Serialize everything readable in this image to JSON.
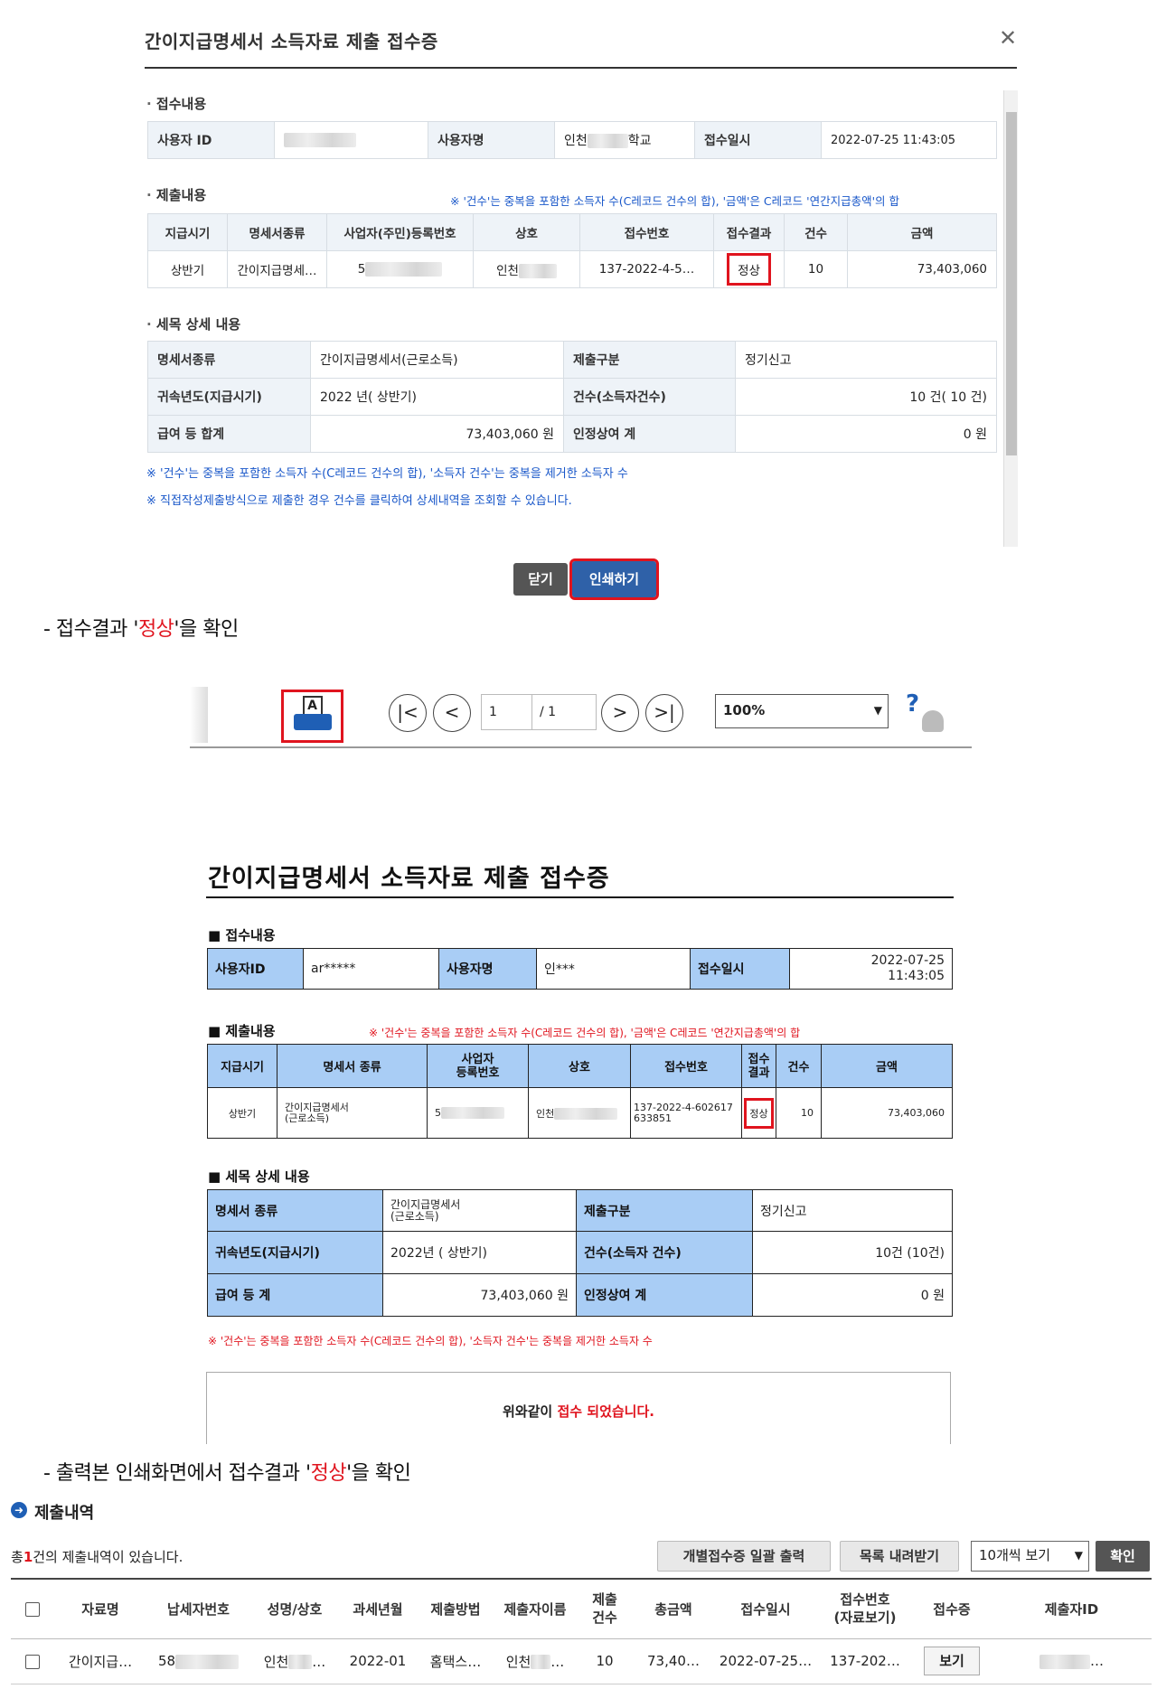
{
  "popup": {
    "title": "간이지급명세서 소득자료 제출 접수증",
    "close_glyph": "✕",
    "sec1_label": "접수내용",
    "user_id_label": "사용자 ID",
    "user_name_label": "사용자명",
    "user_name_prefix": "인천",
    "user_name_suffix": "학교",
    "receipt_time_label": "접수일시",
    "receipt_time": "2022-07-25 11:43:05",
    "sec2_label": "제출내용",
    "sec2_note": "※ '건수'는 중복을 포함한 소득자 수(C레코드 건수의 합), '금액'은 C레코드 '연간지급총액'의 합",
    "sub_headers": [
      "지급시기",
      "명세서종류",
      "사업자(주민)등록번호",
      "상호",
      "접수번호",
      "접수결과",
      "건수",
      "금액"
    ],
    "sub_row": {
      "period": "상반기",
      "type": "간이지급명세…",
      "reg_prefix": "5",
      "name_prefix": "인천",
      "receipt_no": "137-2022-4-5…",
      "result": "정상",
      "count": "10",
      "amount": "73,403,060"
    },
    "sec3_label": "세목 상세 내용",
    "d_type_label": "명세서종류",
    "d_type": "간이지급명세서(근로소득)",
    "d_kind_label": "제출구분",
    "d_kind": "정기신고",
    "d_year_label": "귀속년도(지급시기)",
    "d_year": "2022 년( 상반기)",
    "d_count_label": "건수(소득자건수)",
    "d_count": "10  건( 10 건)",
    "d_pay_label": "급여 등 합계",
    "d_pay": "73,403,060 원",
    "d_bonus_label": "인정상여 계",
    "d_bonus": "0 원",
    "note1": "※ '건수'는 중복을 포함한 소득자 수(C레코드 건수의 합), '소득자 건수'는 중복을 제거한 소득자 수",
    "note2": "※ 직접작성제출방식으로 제출한 경우 건수를 클릭하여 상세내역을 조회할 수 있습니다.",
    "btn_close": "닫기",
    "btn_print": "인쇄하기"
  },
  "caption1": {
    "pre": "- 접수결과 '",
    "hl": "정상",
    "post": "'을 확인"
  },
  "viewer": {
    "print_glyph": "A",
    "first": "|<",
    "prev": "<",
    "next": ">",
    "last": ">|",
    "page_current": "1",
    "page_total": "/ 1",
    "zoom": "100%",
    "help": "?"
  },
  "printed": {
    "title": "간이지급명세서 소득자료 제출 접수증",
    "sec1": "접수내용",
    "uid_label": "사용자ID",
    "uid": "ar*****",
    "uname_label": "사용자명",
    "uname": "인***",
    "time_label": "접수일시",
    "time_date": "2022-07-25",
    "time_clock": "11:43:05",
    "sec2": "제출내용",
    "sec2_note": "※ '건수'는 중복을 포함한 소득자 수(C레코드 건수의 합), '금액'은 C레코드 '연간지급총액'의 합",
    "h_period": "지급시기",
    "h_type": "명세서 종류",
    "h_reg1": "사업자",
    "h_reg2": "등록번호",
    "h_name": "상호",
    "h_no": "접수번호",
    "h_res1": "접수",
    "h_res2": "결과",
    "h_count": "건수",
    "h_amount": "금액",
    "r_period": "상반기",
    "r_type1": "간이지급명세서",
    "r_type2": "(근로소득)",
    "r_reg_prefix": "5",
    "r_name_prefix": "인천",
    "r_no1": "137-2022-4-602617",
    "r_no2": "633851",
    "r_result": "정상",
    "r_count": "10",
    "r_amount": "73,403,060",
    "sec3": "세목 상세 내용",
    "d_type_label": "명세서 종류",
    "d_type1": "간이지급명세서",
    "d_type2": "(근로소득)",
    "d_kind_label": "제출구분",
    "d_kind": "정기신고",
    "d_year_label": "귀속년도(지급시기)",
    "d_year": "2022년 ( 상반기)",
    "d_count_label": "건수(소득자 건수)",
    "d_count": "10건 (10건)",
    "d_pay_label": "급여 등 계",
    "d_pay": "73,403,060 원",
    "d_bonus_label": "인정상여 계",
    "d_bonus": "0 원",
    "note": "※ '건수'는 중복을 포함한 소득자 수(C레코드 건수의 합), '소득자 건수'는 중복을 제거한 소득자 수",
    "confirm_pre": "위와같이",
    "confirm_hl": "접수 되었습니다."
  },
  "caption2": {
    "pre": "- 출력본 인쇄화면에서 접수결과 '",
    "hl": "정상",
    "post": "'을 확인"
  },
  "list": {
    "title": "제출내역",
    "count_pre": "총",
    "count_num": "1",
    "count_post": "건의 제출내역이 있습니다.",
    "btn_bulk": "개별접수증 일괄 출력",
    "btn_download": "목록 내려받기",
    "page_size": "10개씩 보기",
    "btn_ok": "확인",
    "headers": [
      "자료명",
      "납세자번호",
      "성명/상호",
      "과세년월",
      "제출방법",
      "제출자이름",
      "제출\n건수",
      "총금액",
      "접수일시",
      "접수번호\n(자료보기)",
      "접수증",
      "제출자ID"
    ],
    "row": {
      "name": "간이지급…",
      "taxno_prefix": "58",
      "corp_prefix": "인천",
      "corp_suffix": "…",
      "month": "2022-01",
      "method": "홈택스…",
      "submitter_prefix": "인천",
      "submitter_suffix": "…",
      "count": "10",
      "total": "73,40…",
      "time": "2022-07-25…",
      "no": "137-202…",
      "view": "보기",
      "id_suffix": "…"
    }
  }
}
